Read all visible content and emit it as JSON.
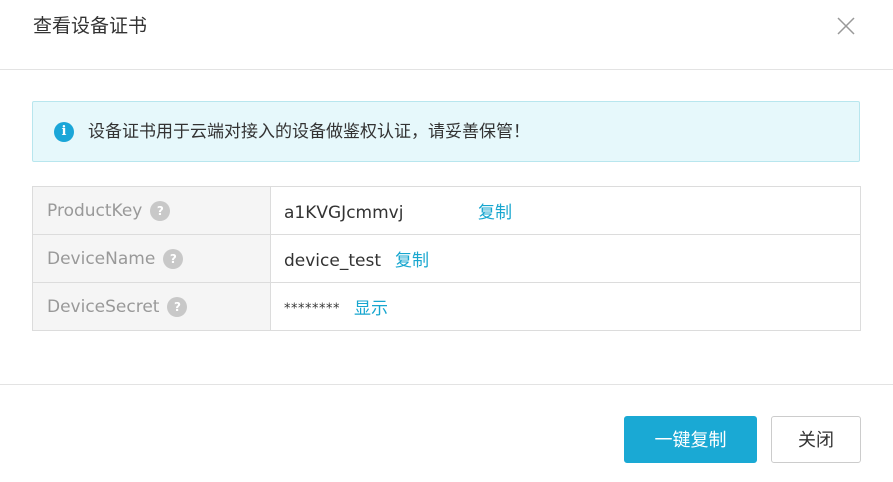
{
  "dialog": {
    "title": "查看设备证书"
  },
  "notice": {
    "text": "设备证书用于云端对接入的设备做鉴权认证，请妥善保管！",
    "icon": "info-icon"
  },
  "fields": {
    "product_key": {
      "label": "ProductKey",
      "value": "a1KVGJcmmvj",
      "action": "复制"
    },
    "device_name": {
      "label": "DeviceName",
      "value": "device_test",
      "action": "复制"
    },
    "device_secret": {
      "label": "DeviceSecret",
      "value": "********",
      "action": "显示"
    }
  },
  "help_icon_glyph": "?",
  "footer": {
    "copy_all_label": "一键复制",
    "close_label": "关闭"
  },
  "colors": {
    "accent": "#1aa9d4",
    "link": "#17a6cf",
    "notice_bg": "#e6f8fb"
  }
}
